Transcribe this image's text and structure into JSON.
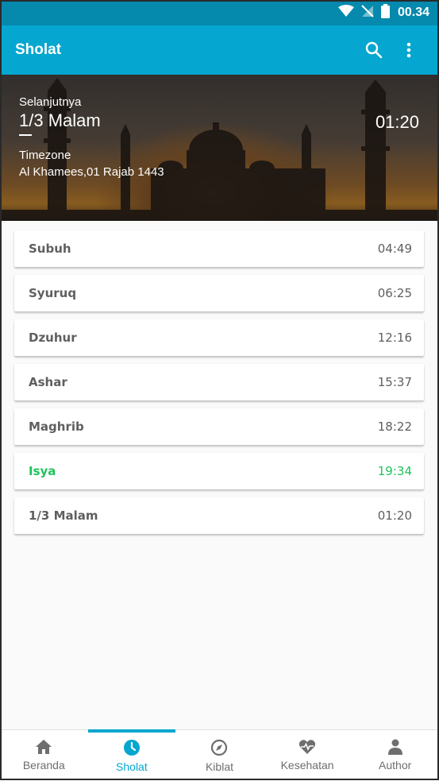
{
  "status_bar": {
    "time": "00.34",
    "background": "#0589ad"
  },
  "app_bar": {
    "title": "Sholat",
    "background": "#05a6d0",
    "actions": [
      {
        "icon": "search-icon"
      },
      {
        "icon": "more-vert-icon"
      }
    ]
  },
  "hero": {
    "next_label": "Selanjutnya",
    "next_prayer": "1/3 Malam",
    "countdown": "01:20",
    "timezone_label": "Timezone",
    "hijri_date": "Al Khamees,01 Rajab 1443"
  },
  "prayers": [
    {
      "name": "Subuh",
      "time": "04:49",
      "active": false
    },
    {
      "name": "Syuruq",
      "time": "06:25",
      "active": false
    },
    {
      "name": "Dzuhur",
      "time": "12:16",
      "active": false
    },
    {
      "name": "Ashar",
      "time": "15:37",
      "active": false
    },
    {
      "name": "Maghrib",
      "time": "18:22",
      "active": false
    },
    {
      "name": "Isya",
      "time": "19:34",
      "active": true
    },
    {
      "name": "1/3 Malam",
      "time": "01:20",
      "active": false
    }
  ],
  "colors": {
    "active_prayer": "#1ec35a",
    "accent": "#05a6d0",
    "text": "#5f5f5f"
  },
  "bottom_nav": [
    {
      "label": "Beranda",
      "icon": "home-icon",
      "active": false
    },
    {
      "label": "Sholat",
      "icon": "clock-icon",
      "active": true
    },
    {
      "label": "Kiblat",
      "icon": "compass-icon",
      "active": false
    },
    {
      "label": "Kesehatan",
      "icon": "health-icon",
      "active": false
    },
    {
      "label": "Author",
      "icon": "person-icon",
      "active": false
    }
  ]
}
